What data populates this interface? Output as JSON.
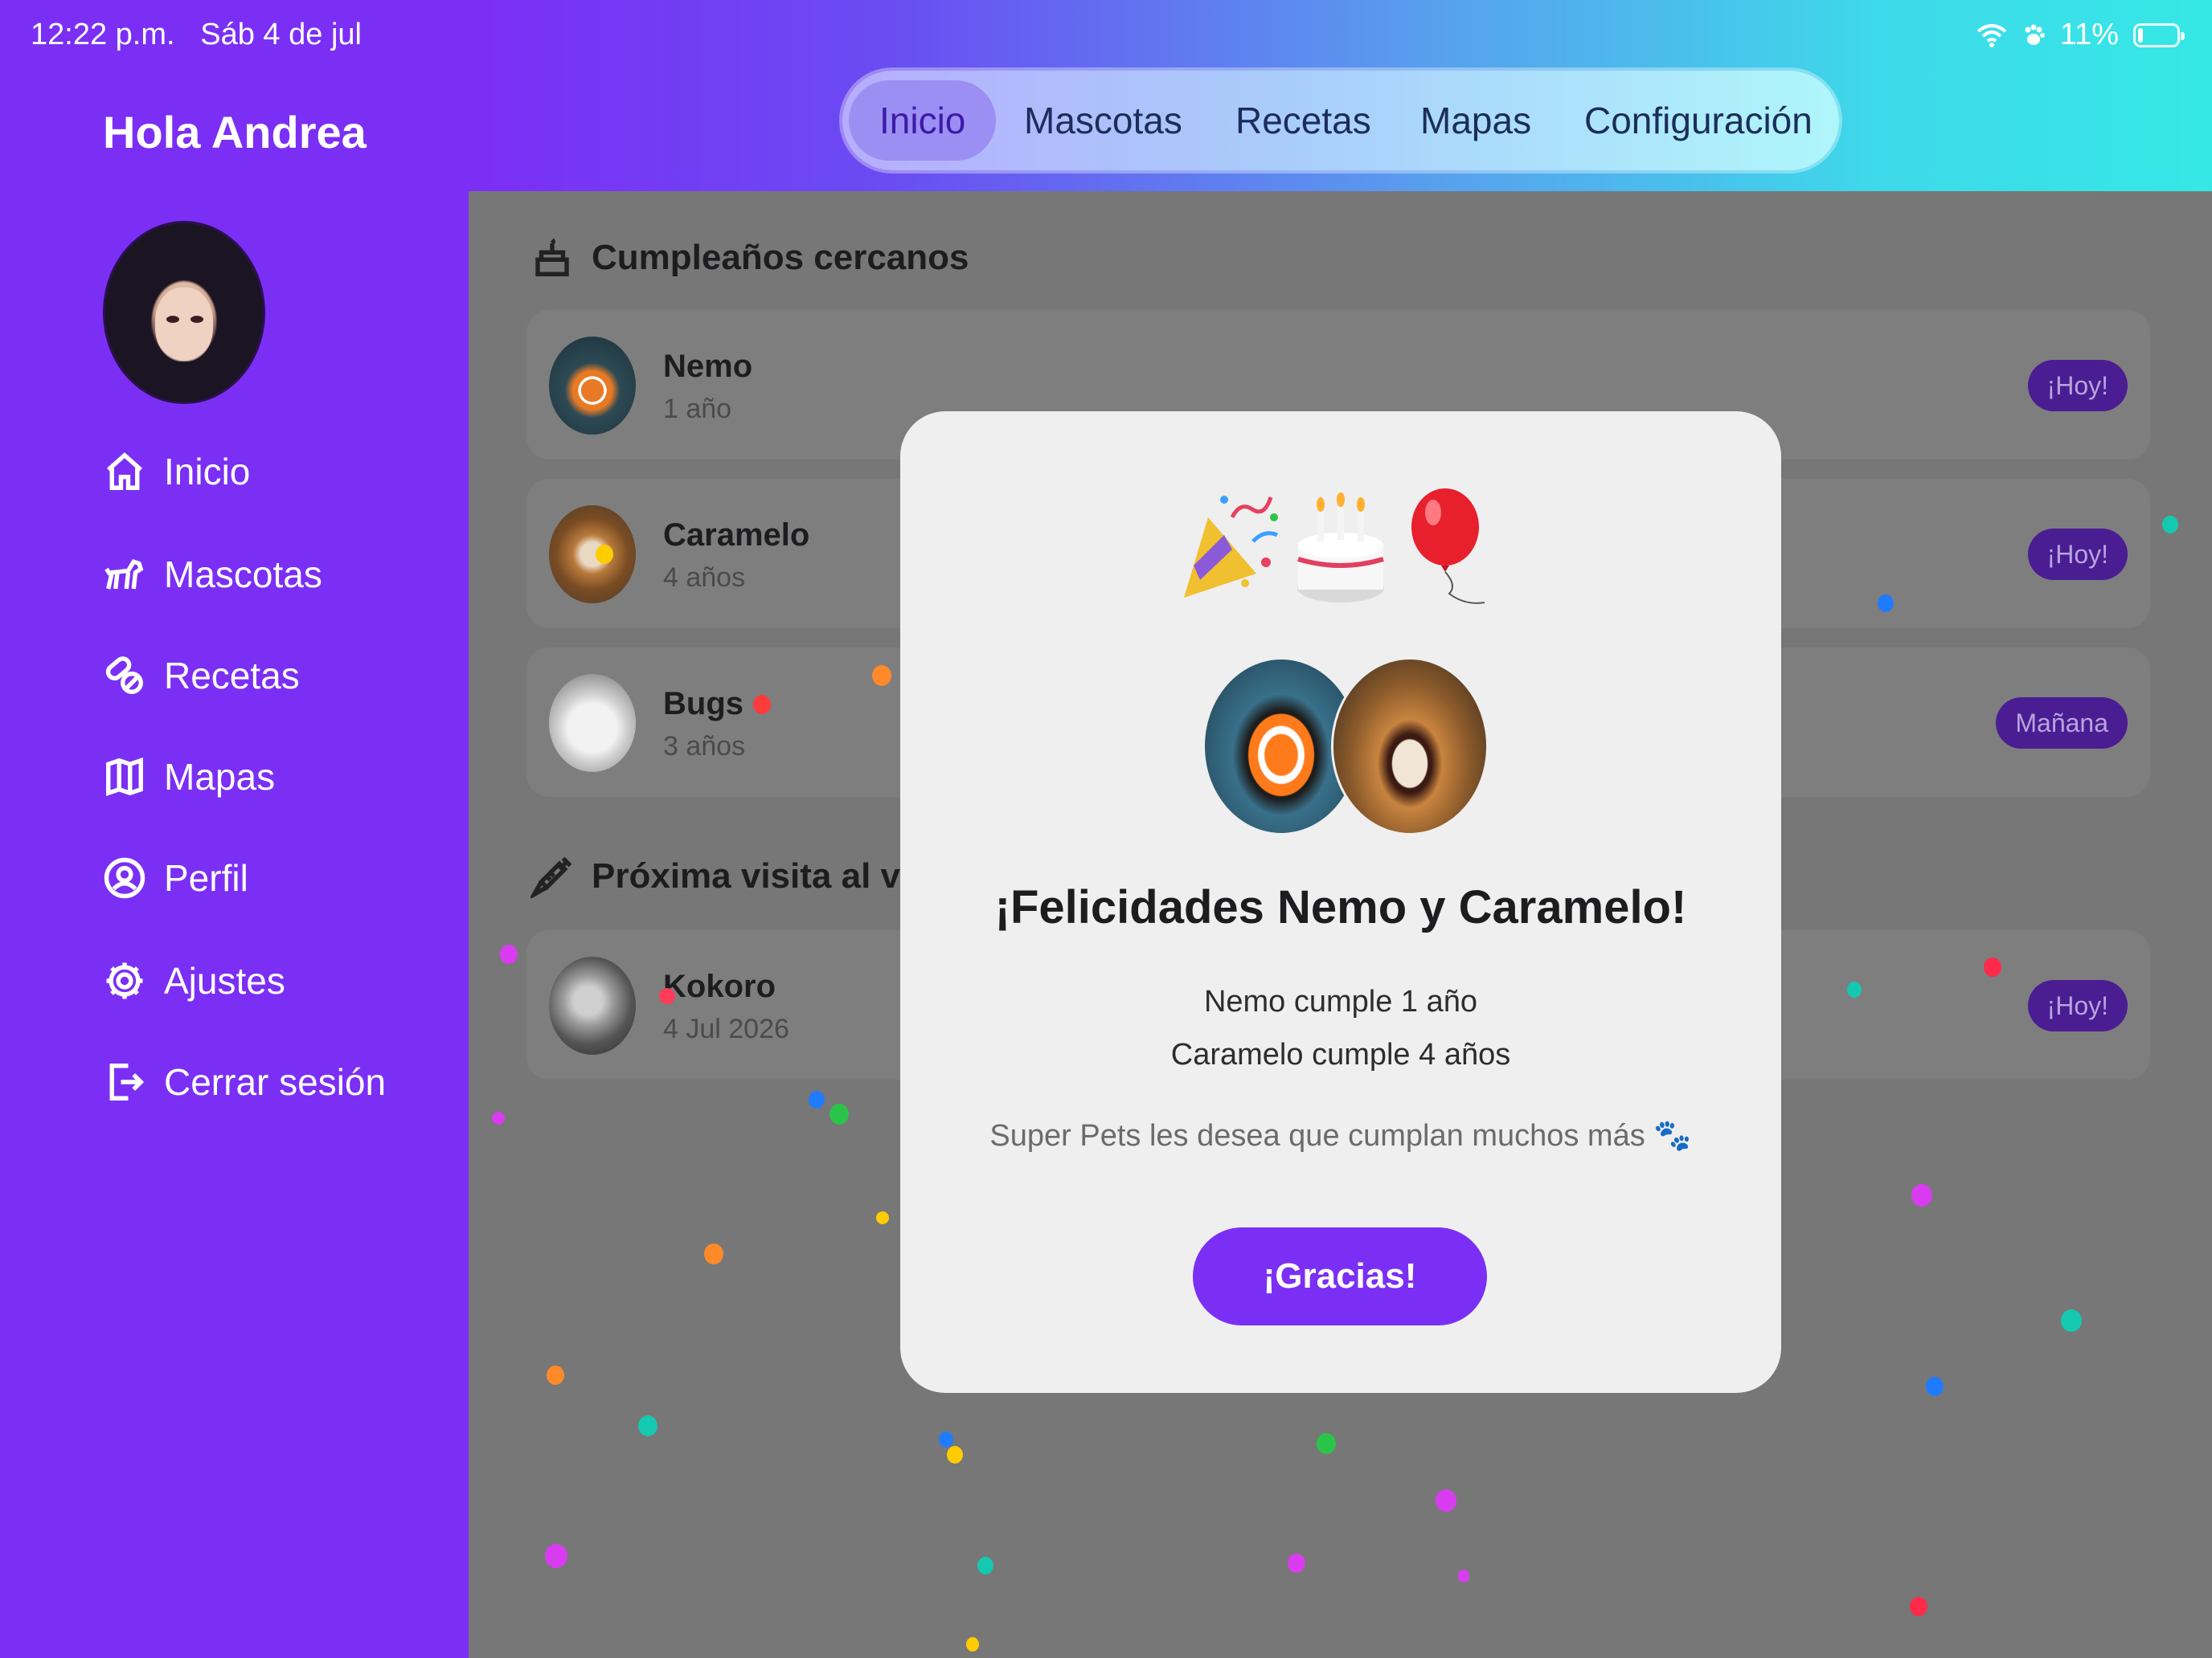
{
  "status_bar": {
    "time": "12:22 p.m.",
    "date": "Sáb 4 de jul",
    "battery": "11%"
  },
  "sidebar": {
    "greeting": "Hola Andrea",
    "items": [
      {
        "label": "Inicio",
        "icon": "house-icon"
      },
      {
        "label": "Mascotas",
        "icon": "dog-icon"
      },
      {
        "label": "Recetas",
        "icon": "pills-icon"
      },
      {
        "label": "Mapas",
        "icon": "map-icon"
      },
      {
        "label": "Perfil",
        "icon": "person-circle-icon"
      },
      {
        "label": "Ajustes",
        "icon": "gear-icon"
      },
      {
        "label": "Cerrar sesión",
        "icon": "logout-icon"
      }
    ]
  },
  "tabs": [
    {
      "label": "Inicio",
      "active": true
    },
    {
      "label": "Mascotas",
      "active": false
    },
    {
      "label": "Recetas",
      "active": false
    },
    {
      "label": "Mapas",
      "active": false
    },
    {
      "label": "Configuración",
      "active": false
    }
  ],
  "birthdays": {
    "title": "Cumpleaños cercanos",
    "items": [
      {
        "name": "Nemo",
        "age": "1 año",
        "badge": "¡Hoy!"
      },
      {
        "name": "Caramelo",
        "age": "4 años",
        "badge": "¡Hoy!"
      },
      {
        "name": "Bugs",
        "age": "3 años",
        "badge": "Mañana"
      }
    ]
  },
  "vet": {
    "title": "Próxima visita al vete",
    "items": [
      {
        "name": "Kokoro",
        "date": "4 Jul 2026",
        "badge": "¡Hoy!"
      }
    ]
  },
  "modal": {
    "title": "¡Felicidades Nemo y Caramelo!",
    "line1": "Nemo cumple 1 año",
    "line2": "Caramelo cumple 4 años",
    "wish": "Super Pets les desea que cumplan muchos más 🐾",
    "button": "¡Gracias!"
  },
  "colors": {
    "accent": "#7b2ff5",
    "badge": "#4a1d93",
    "overlay": "#777777",
    "modal": "#efefef"
  }
}
